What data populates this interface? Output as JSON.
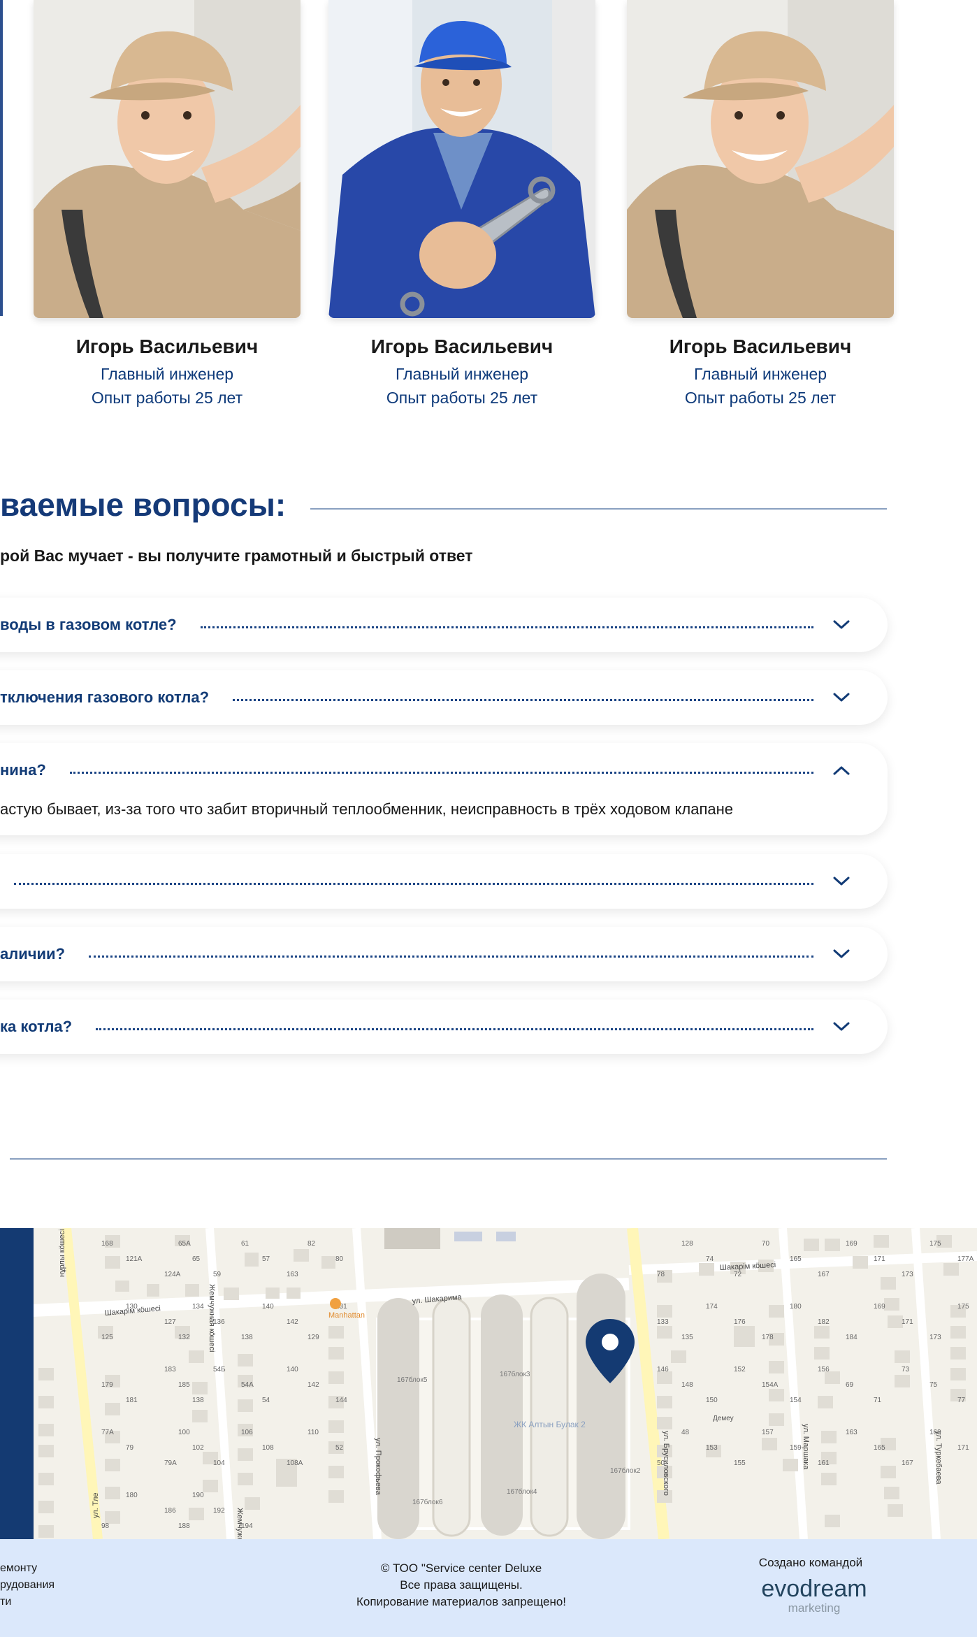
{
  "team": [
    {
      "name": "Игорь Васильевич",
      "role": "Главный инженер",
      "experience": "Опыт работы 25 лет",
      "cap_color": "#d8b891",
      "shirt_color": "#c9ad8a"
    },
    {
      "name": "Игорь Васильевич",
      "role": "Главный инженер",
      "experience": "Опыт работы 25 лет",
      "cap_color": "#2b62d9",
      "shirt_color": "#2848a8"
    },
    {
      "name": "Игорь Васильевич",
      "role": "Главный инженер",
      "experience": "Опыт работы 25 лет",
      "cap_color": "#d8b891",
      "shirt_color": "#c9ad8a"
    }
  ],
  "faq": {
    "title": "ваемые вопросы:",
    "subtitle": "рой Вас мучает - вы получите грамотный и быстрый ответ",
    "items": [
      {
        "question": "воды в газовом котле?",
        "expanded": false
      },
      {
        "question": "тключения газового котла?",
        "expanded": false
      },
      {
        "question": "нина?",
        "expanded": true,
        "answer": "астую бывает, из-за того что забит вторичный теплообменник, неисправность в трёх ходовом клапане"
      },
      {
        "question": "",
        "expanded": false
      },
      {
        "question": "аличии?",
        "expanded": false
      },
      {
        "question": "ка котла?",
        "expanded": false
      }
    ]
  },
  "map": {
    "streets": [
      "нұрлы кӧшесі",
      "Шакарім кӧшесі",
      "ул. Шакарима",
      "Шакарім кӧшесі",
      "Жемчужная кӧшесі",
      "ул. Тле",
      "ул. Прокофьева",
      "ул. Брусиловского",
      "ул. Маршака",
      "ул. Туркебаева",
      "Жемчужная ул."
    ],
    "places": [
      "Manhattan",
      "ЖК Алтын Булак 2",
      "Демеу",
      "167блок5",
      "167блок3",
      "167блок2",
      "167блок6",
      "167блок4"
    ],
    "house_numbers": [
      "168",
      "121А",
      "124А",
      "65А",
      "65",
      "59",
      "61",
      "57",
      "163",
      "82",
      "80",
      "78",
      "128",
      "74",
      "72",
      "70",
      "165",
      "167",
      "169",
      "171",
      "173",
      "175",
      "177А",
      "125",
      "130",
      "127",
      "132",
      "134",
      "136",
      "138",
      "140",
      "142",
      "129",
      "131",
      "133",
      "135",
      "174",
      "176",
      "178",
      "180",
      "182",
      "184",
      "169",
      "171",
      "173",
      "175",
      "179",
      "181",
      "183",
      "185",
      "138",
      "54Б",
      "54А",
      "54",
      "140",
      "142",
      "144",
      "146",
      "148",
      "150",
      "152",
      "154А",
      "154",
      "156",
      "69",
      "71",
      "73",
      "75",
      "77",
      "77А",
      "79",
      "79А",
      "100",
      "102",
      "104",
      "106",
      "108",
      "108А",
      "110",
      "52",
      "50",
      "48",
      "153",
      "155",
      "157",
      "159",
      "161",
      "163",
      "165",
      "167",
      "169",
      "171",
      "98",
      "180",
      "186",
      "188",
      "190",
      "192",
      "194"
    ],
    "pin_color": "#143a72"
  },
  "footer": {
    "left_lines": [
      "емонту",
      "рудования",
      "ти"
    ],
    "copyright": "© ТОО \"Service center Deluxe",
    "rights": "Все права защищены.",
    "no_copy": "Копирование материалов запрещено!",
    "created_by": "Создано командой",
    "logo_main": "evodream",
    "logo_sub": "marketing"
  }
}
